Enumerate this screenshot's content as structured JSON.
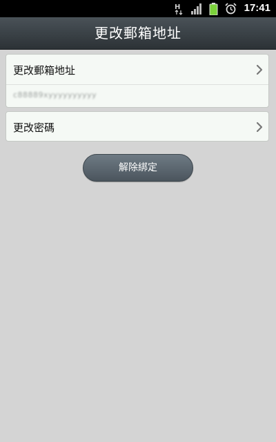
{
  "status_bar": {
    "time": "17:41",
    "icons": [
      "network-h-icon",
      "signal-icon",
      "battery-icon",
      "alarm-icon"
    ]
  },
  "header": {
    "title": "更改郵箱地址"
  },
  "email_card": {
    "label": "更改郵箱地址",
    "value": "c88889xyyyyyyyyyy"
  },
  "password_card": {
    "label": "更改密碼"
  },
  "unbind_button": {
    "label": "解除綁定"
  },
  "colors": {
    "background": "#d4d4d4",
    "title_bar": "#3a4247",
    "button": "#5d6871",
    "battery": "#7bd23a"
  }
}
